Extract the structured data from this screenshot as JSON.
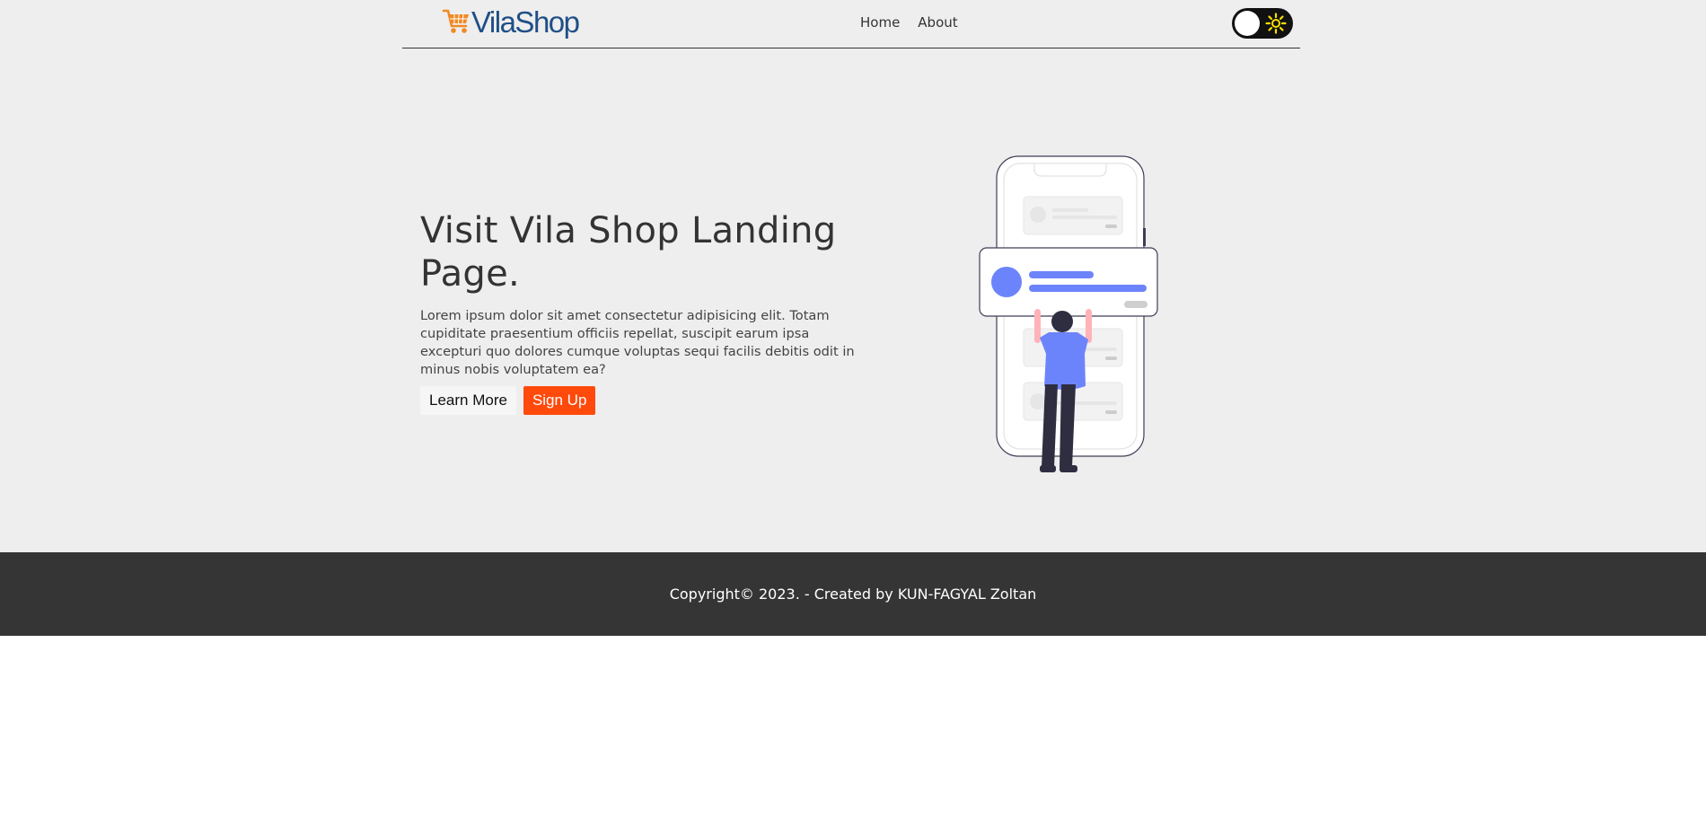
{
  "header": {
    "logo_text": "VilaShop",
    "logo_icon": "shopping-cart-icon",
    "nav": [
      {
        "label": "Home"
      },
      {
        "label": "About"
      }
    ],
    "theme_toggle": {
      "state": "light",
      "icon": "sun-icon"
    }
  },
  "hero": {
    "title": "Visit Vila Shop Landing Page.",
    "text": "Lorem ipsum dolor sit amet consectetur adipisicing elit. Totam cupiditate praesentium officiis repellat, suscipit earum ipsa excepturi quo dolores cumque voluptas sequi facilis debitis odit in minus nobis voluptatem ea?",
    "learn_more_label": "Learn More",
    "sign_up_label": "Sign Up",
    "illustration_icon": "person-with-phone-illustration"
  },
  "footer": {
    "copyright": "Copyright© 2023. - Created by KUN-FAGYAL Zoltan"
  },
  "colors": {
    "background": "#eeeeee",
    "brand_blue": "#1f4f86",
    "cart_orange": "#f08a24",
    "signup_orange": "#ff4a0b",
    "footer_bg": "#353535",
    "accent_blue": "#6c84fb"
  }
}
